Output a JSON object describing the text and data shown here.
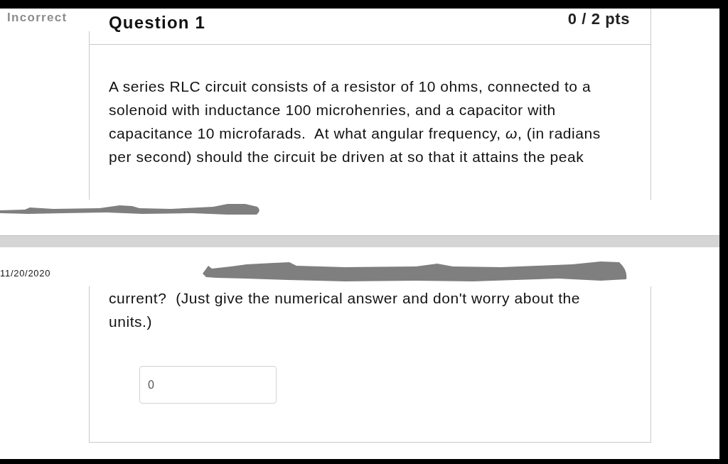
{
  "result_label": "Incorrect",
  "question": {
    "title": "Question 1",
    "score": "0 / 2 pts",
    "text_before_break": "A series RLC circuit consists of a resistor of 10 ohms, connected to a solenoid with inductance 100 microhenries, and a capacitor with capacitance 10 microfarads.  At what angular frequency, *ω*, (in radians per second) should the circuit be driven at so that it attains the peak",
    "print_date": "11/20/2020",
    "text_after_break": "current?  (Just give the numerical answer and don't worry about the units.)",
    "answer_field": {
      "value": "0"
    }
  }
}
